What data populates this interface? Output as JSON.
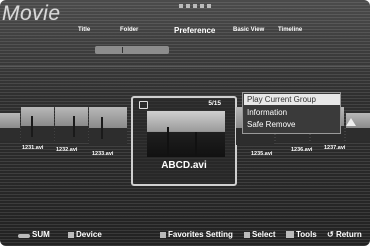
{
  "header": {
    "title": "Movie",
    "tabs": [
      {
        "label": "Title",
        "active": false
      },
      {
        "label": "Folder",
        "active": false
      },
      {
        "label": "Preference",
        "active": true
      },
      {
        "label": "Basic View",
        "active": false
      },
      {
        "label": "Timeline",
        "active": false
      }
    ]
  },
  "files": [
    {
      "name": "1231.avi"
    },
    {
      "name": "1232.avi"
    },
    {
      "name": "1233.avi"
    },
    {
      "name": "1235.avi"
    },
    {
      "name": "1236.avi"
    },
    {
      "name": "1237.avi"
    }
  ],
  "focused": {
    "name": "ABCD.avi",
    "counter": "5/15"
  },
  "context_menu": {
    "items": [
      {
        "label": "Play Current Group",
        "selected": true
      },
      {
        "label": "Information",
        "selected": false
      },
      {
        "label": "Safe Remove",
        "selected": false
      }
    ]
  },
  "footer": {
    "sum": "SUM",
    "device": "Device",
    "favorites": "Favorites Setting",
    "select": "Select",
    "tools": "Tools",
    "return": "Return"
  },
  "colors": {
    "selection": "#e8e8e8",
    "background": "#333333"
  }
}
